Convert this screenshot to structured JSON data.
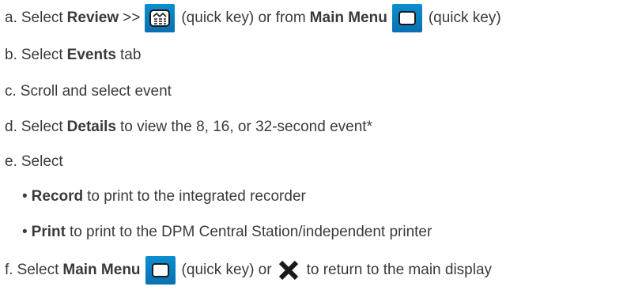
{
  "steps": {
    "a": {
      "marker": "a.",
      "pre": "Select",
      "review": "Review",
      "arrows": ">>",
      "qk1": "(quick key) or from",
      "main_menu": "Main Menu",
      "qk2": "(quick key)",
      "icons": [
        "review-quick-key-icon",
        "main-menu-quick-key-icon"
      ]
    },
    "b": {
      "marker": "b.",
      "pre": "Select",
      "bold": "Events",
      "post": "tab"
    },
    "c": {
      "marker": "c.",
      "text": "Scroll and select event"
    },
    "d": {
      "marker": "d.",
      "pre": "Select",
      "bold": "Details",
      "post": "to view the 8, 16, or 32-second event*"
    },
    "e": {
      "marker": "e.",
      "text": "Select",
      "sub": [
        {
          "bullet": "•",
          "bold": "Record",
          "post": "to print to the integrated recorder"
        },
        {
          "bullet": "•",
          "bold": "Print",
          "post": "to print to the DPM Central Station/independent printer"
        }
      ]
    },
    "f": {
      "marker": "f.",
      "pre": "Select",
      "bold": "Main Menu",
      "qk": "(quick key) or",
      "post": "to return to the main display",
      "icons": [
        "main-menu-quick-key-icon",
        "close-x-icon"
      ]
    }
  },
  "colors": {
    "quick_key_blue": "#0a7fc2",
    "text": "#3a3a3a",
    "x_icon": "#1a1a1a"
  }
}
